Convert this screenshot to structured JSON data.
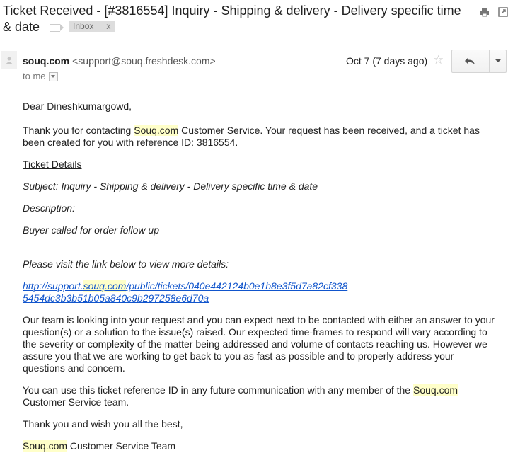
{
  "subject": {
    "title": "Ticket Received - [#3816554] Inquiry - Shipping & delivery - Delivery specific time & date",
    "label": "Inbox",
    "label_close": "x"
  },
  "icons": {
    "print": "print-icon",
    "new_window": "new-window-icon",
    "reply": "reply-icon",
    "star": "star-icon",
    "avatar": "person-icon"
  },
  "header": {
    "sender_name": "souq.com",
    "sender_email": "<support@souq.freshdesk.com>",
    "recipient": "to me",
    "date": "Oct 7 (7 days ago)"
  },
  "body": {
    "greeting": "Dear Dineshkumargowd,",
    "p1_a": "Thank you for contacting ",
    "p1_brand": "Souq.com",
    "p1_b": " Customer Service. Your request has been received, and a ticket has been created for you with reference ID: 3816554.",
    "details_heading": "Ticket Details",
    "subject_line": "Subject: Inquiry - Shipping & delivery - Delivery specific time & date",
    "description_label": "Description:",
    "description_text": "Buyer called for order follow up",
    "visit_text": "Please visit the link below to view more details:",
    "link_a": "http://support.",
    "link_brand": "souq.com",
    "link_b": "/public/tickets/040e442124b0e1b8e3f5d7a82cf338",
    "link_c": "5454dc3b3b51b05a840c9b297258e6d70a",
    "p_team": "Our team is looking into your request and you can expect next to be contacted with either an answer to your question(s) or a solution to the issue(s) raised. Our expected time-frames to respond will vary according to the severity or complexity of the matter being addressed and volume of contacts reaching us. However we assure you that we are working to get back to you as fast as possible and to properly address your questions and concern.",
    "p_ref_a": "You can use this ticket reference ID in any future communication with any member of the ",
    "p_ref_brand": "Souq.com",
    "p_ref_b": " Customer Service team.",
    "thanks": "Thank you and wish you all the best,",
    "sign_brand": "Souq.com",
    "sign_rest": " Customer Service Team"
  },
  "colors": {
    "highlight": "#ffffc9",
    "link": "#1155cc",
    "label_bg": "#dddddd"
  }
}
